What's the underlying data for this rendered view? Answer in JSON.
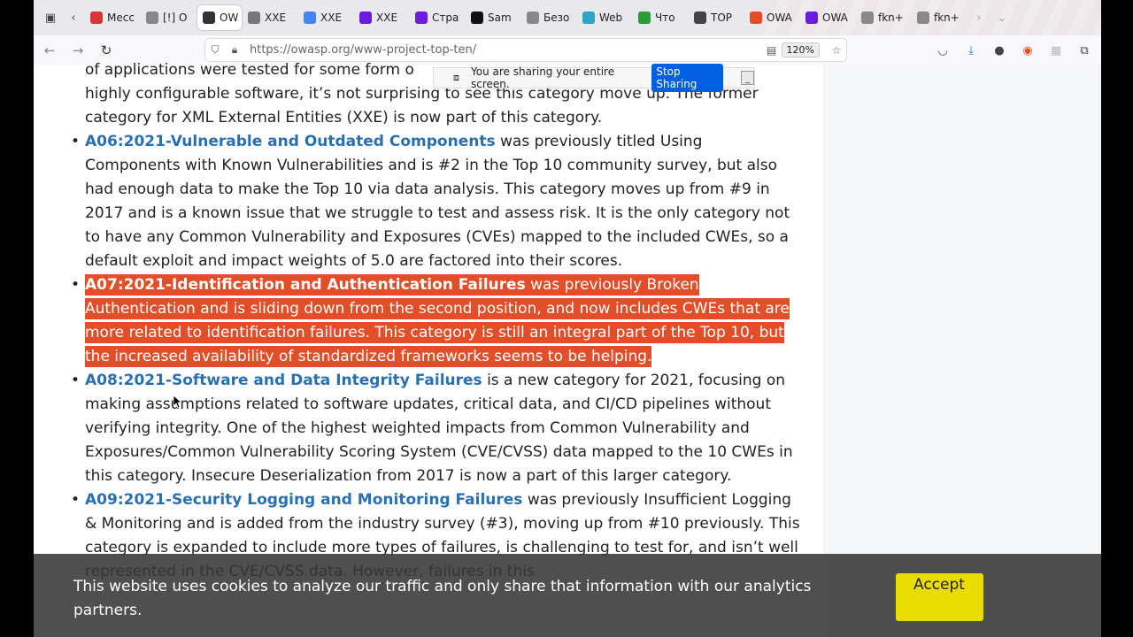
{
  "tabs": [
    {
      "label": "Mecc",
      "color": "#d33"
    },
    {
      "label": "[!] O",
      "color": "#888"
    },
    {
      "label": "OW",
      "color": "#333",
      "active": true
    },
    {
      "label": "XXE",
      "color": "#777"
    },
    {
      "label": "XXE",
      "color": "#4285f4"
    },
    {
      "label": "XXE",
      "color": "#6a1be0"
    },
    {
      "label": "Стра",
      "color": "#6a1be0"
    },
    {
      "label": "Sam",
      "color": "#111"
    },
    {
      "label": "Безо",
      "color": "#888"
    },
    {
      "label": "Web",
      "color": "#2aa6c7"
    },
    {
      "label": "Что",
      "color": "#2a9d3a"
    },
    {
      "label": "TOP",
      "color": "#444"
    },
    {
      "label": "OWA",
      "color": "#e14e28"
    },
    {
      "label": "OWA",
      "color": "#6a1be0"
    },
    {
      "label": "fkn+",
      "color": "#888"
    },
    {
      "label": "fkn+",
      "color": "#888"
    }
  ],
  "navbar": {
    "url": "https://owasp.org/www-project-top-ten/",
    "zoom": "120%"
  },
  "share_banner": {
    "text": "You are sharing your entire screen.",
    "stop_label": "Stop Sharing",
    "minimize_label": "_"
  },
  "article": {
    "intro_top": "of applications were tested for some form o",
    "intro_rest": "highly configurable software, it’s not surprising to see this category move up. The former category for XML External Entities (XXE) is now part of this category.",
    "items": [
      {
        "title": "A06:2021-Vulnerable and Outdated Components",
        "body": " was previously titled Using Components with Known Vulnerabilities and is #2 in the Top 10 community survey, but also had enough data to make the Top 10 via data analysis. This category moves up from #9 in 2017 and is a known issue that we struggle to test and assess risk. It is the only category not to have any Common Vulnerability and Exposures (CVEs) mapped to the included CWEs, so a default exploit and impact weights of 5.0 are factored into their scores."
      },
      {
        "title": "A07:2021-Identification and Authentication Failures",
        "body": " was previously Broken Authentication and is sliding down from the second position, and now includes CWEs that are more related to identification failures. This category is still an integral part of the Top 10, but the increased availability of standardized frameworks seems to be helping."
      },
      {
        "title": "A08:2021-Software and Data Integrity Failures",
        "body": " is a new category for 2021, focusing on making assumptions related to software updates, critical data, and CI/CD pipelines without verifying integrity. One of the highest weighted impacts from Common Vulnerability and Exposures/Common Vulnerability Scoring System (CVE/CVSS) data mapped to the 10 CWEs in this category. Insecure Deserialization from 2017 is now a part of this larger category."
      },
      {
        "title": "A09:2021-Security Logging and Monitoring Failures",
        "body": " was previously Insufficient Logging & Monitoring and is added from the industry survey (#3), moving up from #10 previously. This category is expanded to include more types of failures, is challenging to test for, and isn’t well represented in the CVE/CVSS data. However, failures in this"
      }
    ]
  },
  "cookie": {
    "text": "This website uses cookies to analyze our traffic and only share that information with our analytics partners.",
    "accept_label": "Accept"
  },
  "colors": {
    "link": "#2a6fb0",
    "highlight": "#e14e28",
    "accept": "#eadc00"
  }
}
